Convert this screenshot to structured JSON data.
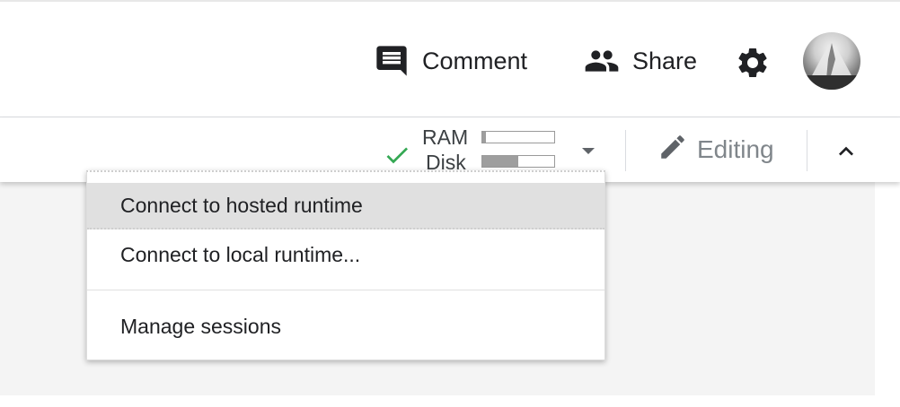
{
  "header": {
    "comment_label": "Comment",
    "share_label": "Share",
    "icons": {
      "comment": "comment-icon",
      "share": "people-icon",
      "settings": "gear-icon"
    }
  },
  "toolbar": {
    "connected_icon": "check-icon",
    "ram_label": "RAM",
    "disk_label": "Disk",
    "ram_usage_fraction": 0.05,
    "disk_usage_fraction": 0.5,
    "editing_label": "Editing",
    "editing_icon": "pencil-icon",
    "collapse_icon": "chevron-up-icon",
    "dropdown_icon": "caret-down-icon"
  },
  "menu": {
    "items": [
      {
        "label": "Connect to hosted runtime",
        "highlighted": true
      },
      {
        "label": "Connect to local runtime..."
      },
      {
        "label": "Manage sessions"
      }
    ]
  },
  "colors": {
    "connected_green": "#34a853",
    "icon_dark": "#202124",
    "editing_gray": "#80868b",
    "menu_highlight": "#e0e0e0"
  }
}
